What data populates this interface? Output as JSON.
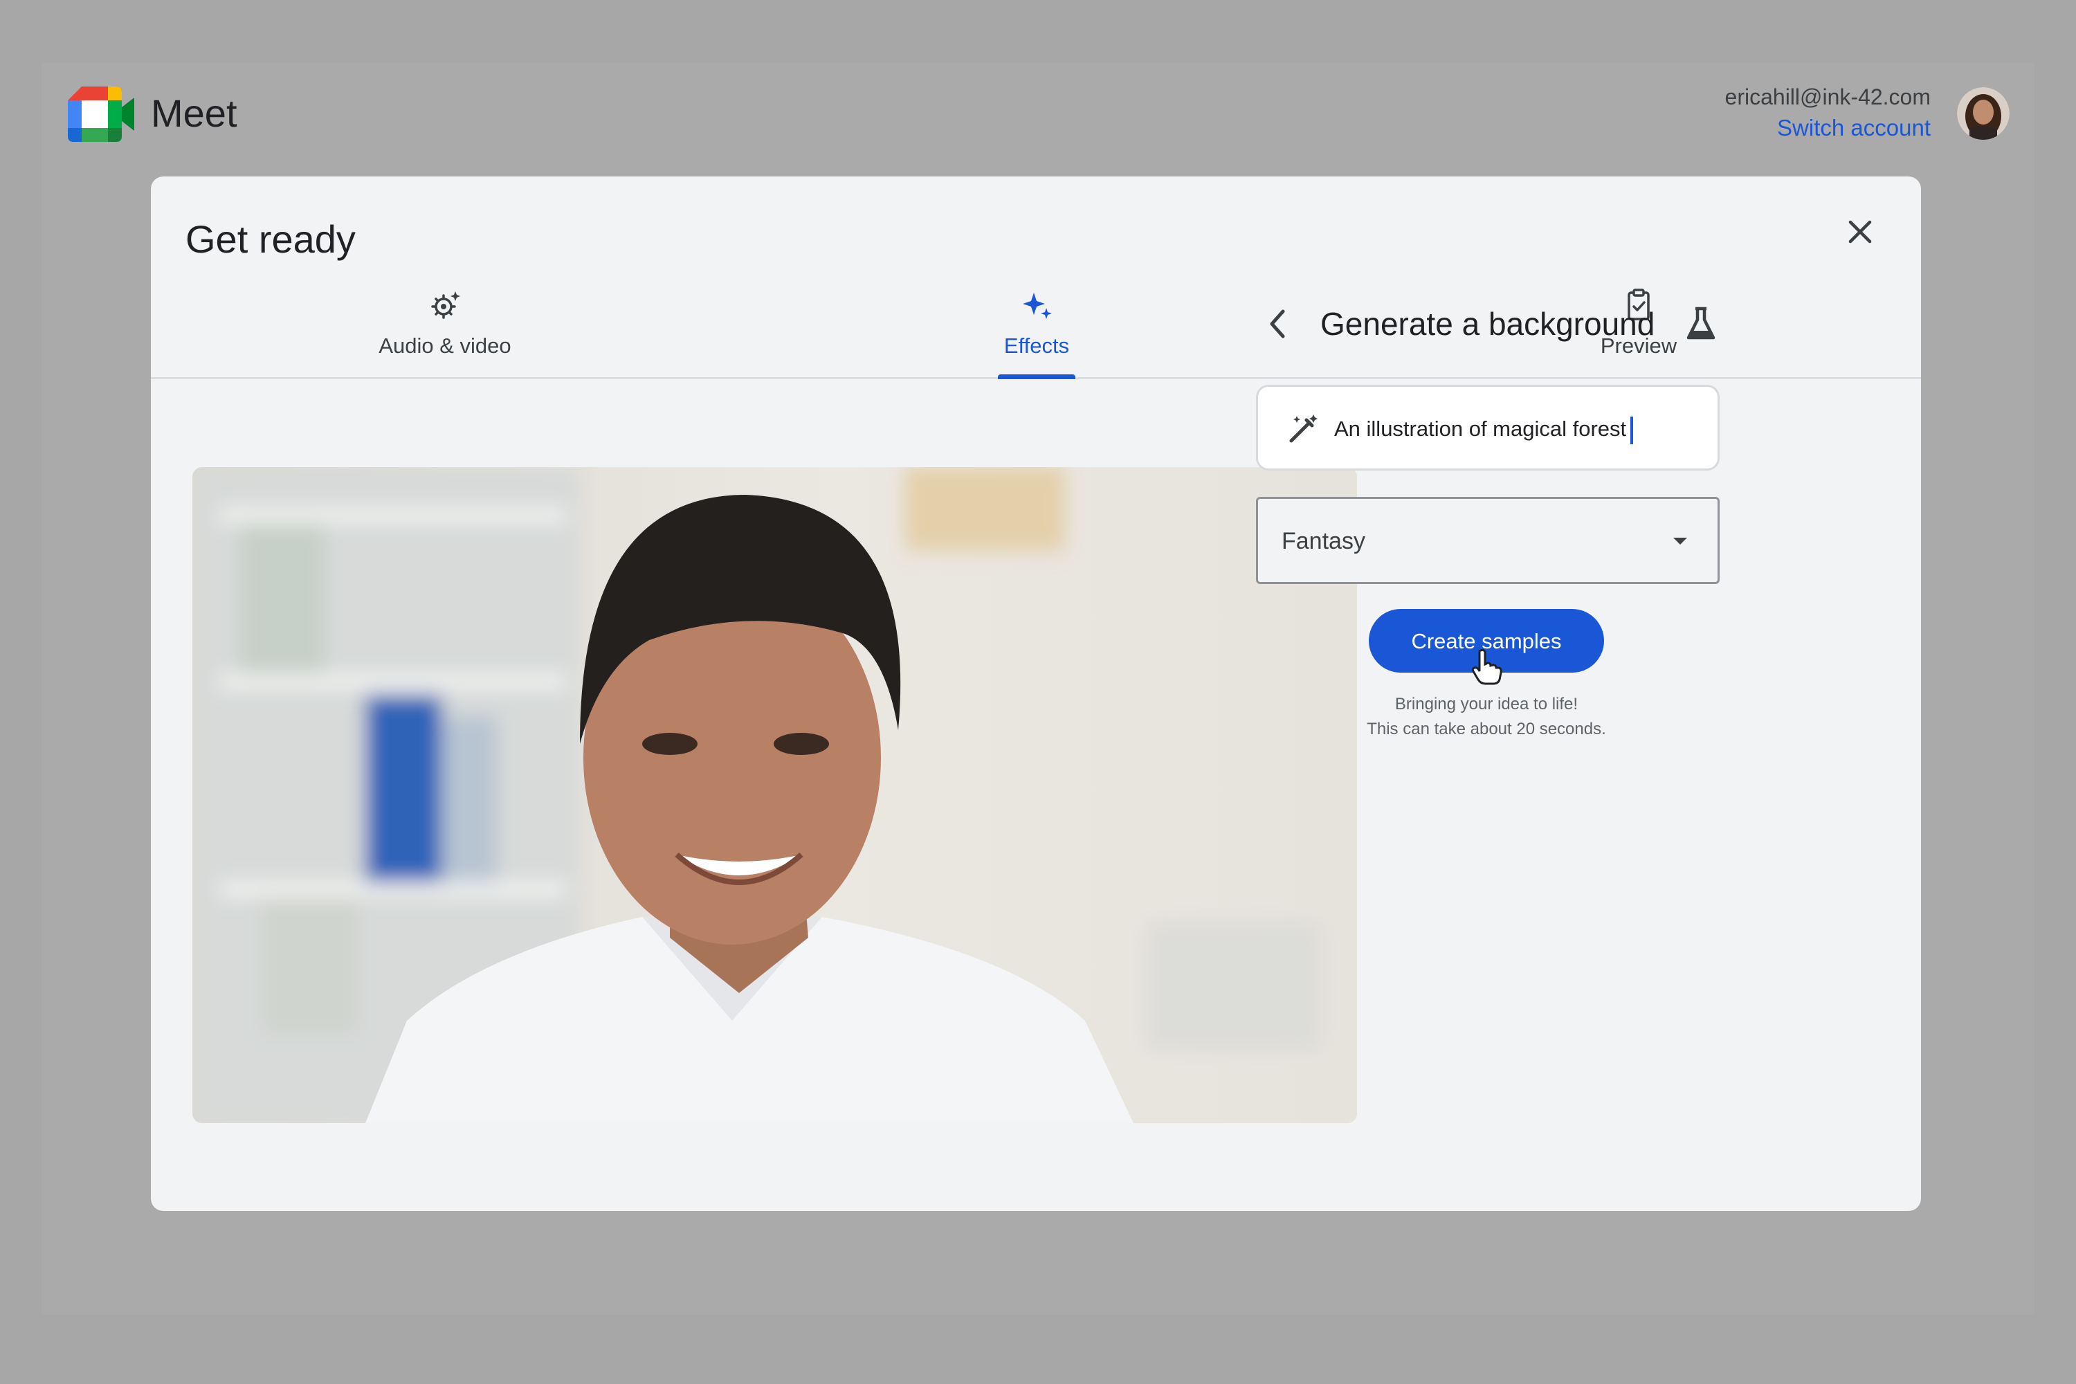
{
  "app": {
    "brand": "Meet",
    "account_email": "ericahill@ink-42.com",
    "switch_account": "Switch account"
  },
  "dialog": {
    "title": "Get ready",
    "tabs": [
      {
        "label": "Audio & video",
        "icon": "gear-sparkle-icon",
        "active": false
      },
      {
        "label": "Effects",
        "icon": "sparkle-icon",
        "active": true
      },
      {
        "label": "Preview",
        "icon": "clipboard-check-icon",
        "active": false
      }
    ]
  },
  "panel": {
    "title": "Generate a background",
    "prompt_value": "An illustration of magical forest",
    "style_selected": "Fantasy",
    "create_button": "Create samples",
    "hint_line1": "Bringing your idea to life!",
    "hint_line2": "This can take about 20 seconds."
  },
  "colors": {
    "accent": "#1a57d6",
    "backdrop": "#a9a9a9",
    "dialog_bg": "#f2f3f5"
  }
}
